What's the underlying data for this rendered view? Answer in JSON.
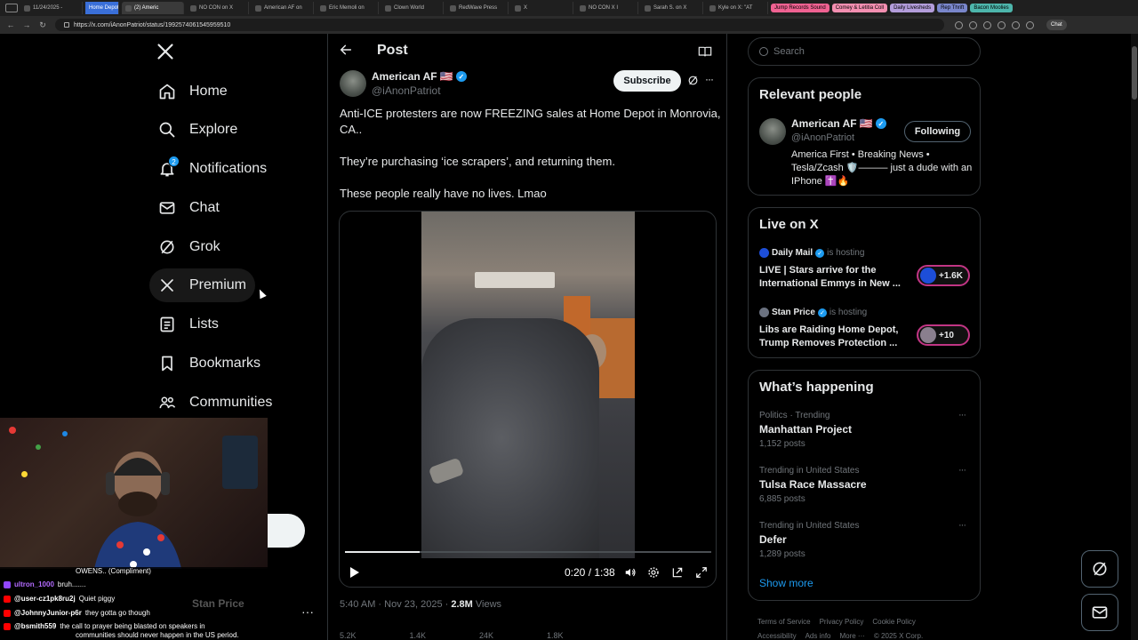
{
  "browser": {
    "tabs": [
      "11/24/2025 -",
      "Home Depot",
      "(2) Americ",
      "NO CON on X",
      "American AF on",
      "Eric Memoli on",
      "Clown World",
      "RedWave Press",
      "X",
      "NO CON X I",
      "Sarah S. on X",
      "Kyle on X: \"AT"
    ],
    "active_tab": "(2) Americ",
    "tab_groups": [
      {
        "label": "Jump Records Sound",
        "color": "#f06292"
      },
      {
        "label": "Comey & Letitia Coll",
        "color": "#f48fb1"
      },
      {
        "label": "Daily Livesheds",
        "color": "#b39ddb"
      },
      {
        "label": "Rep Thrift",
        "color": "#7986cb"
      },
      {
        "label": "Bacon Moolies",
        "color": "#4db6ac"
      }
    ],
    "url": "https://x.com/iAnonPatriot/status/1992574061545959510",
    "chat_label": "Chat"
  },
  "nav": {
    "logo": "X",
    "items": [
      {
        "label": "Home",
        "icon": "home-icon"
      },
      {
        "label": "Explore",
        "icon": "search-icon"
      },
      {
        "label": "Notifications",
        "icon": "bell-icon",
        "badge": "2"
      },
      {
        "label": "Chat",
        "icon": "mail-icon"
      },
      {
        "label": "Grok",
        "icon": "grok-icon"
      },
      {
        "label": "Premium",
        "icon": "x-logo-icon"
      },
      {
        "label": "Lists",
        "icon": "list-icon"
      },
      {
        "label": "Bookmarks",
        "icon": "bookmark-icon"
      },
      {
        "label": "Communities",
        "icon": "people-icon"
      }
    ]
  },
  "stream_chat": {
    "lines": [
      {
        "user": "",
        "text": "OWENS.. (Compliment)",
        "color": "#ffffff"
      },
      {
        "user": "ultron_1000",
        "text": "bruh.......",
        "color": "#b36bff"
      },
      {
        "user": "@user-cz1pk8ru2j",
        "text": "Quiet piggy",
        "color": "#ff3b30"
      },
      {
        "user": "@JohnnyJunior-p6r",
        "text": "they gotta go though",
        "color": "#ff3b30"
      },
      {
        "user": "@bsmith559",
        "text": "the call to prayer being blasted on speakers in",
        "color": "#ff3b30"
      },
      {
        "user": "",
        "text": "communities should never happen in the US period.",
        "color": "#ffffff"
      }
    ],
    "ghost_account": "Stan Price"
  },
  "post": {
    "header_title": "Post",
    "author_name": "American AF 🇺🇸",
    "author_handle": "@iAnonPatriot",
    "subscribe_label": "Subscribe",
    "text_lines": [
      "Anti-ICE protesters are now FREEZING sales at Home Depot in Monrovia, CA..",
      "They’re purchasing ‘ice scrapers’, and returning them.",
      "These people really have no lives. Lmao"
    ],
    "video": {
      "time": "0:20 / 1:38",
      "progress": 0.204
    },
    "timestamp": "5:40 AM · Nov 23, 2025 · ",
    "views_count": "2.8M",
    "views_label": " Views",
    "actions": [
      "5.2K",
      "1.4K",
      "24K",
      "1.8K"
    ]
  },
  "right": {
    "search_placeholder": "Search",
    "relevant_people": {
      "title": "Relevant people",
      "name": "American AF 🇺🇸",
      "handle": "@iAnonPatriot",
      "follow_label": "Following",
      "bio": "America First • Breaking News • Tesla/Zcash 🛡️——— just a dude with an IPhone ✝️🔥"
    },
    "live": {
      "title": "Live on X",
      "items": [
        {
          "host": "Daily Mail",
          "hosting": "is hosting",
          "title": "LIVE | Stars arrive for the International Emmys in New ...",
          "count": "+1.6K",
          "host_color": "#1d4ed8"
        },
        {
          "host": "Stan Price",
          "hosting": "is hosting",
          "title": "Libs are Raiding Home Depot, Trump Removes Protection ...",
          "count": "+10",
          "host_color": "#6b7280"
        }
      ]
    },
    "happening": {
      "title": "What’s happening",
      "trends": [
        {
          "category": "Politics · Trending",
          "name": "Manhattan Project",
          "count": "1,152 posts"
        },
        {
          "category": "Trending in United States",
          "name": "Tulsa Race Massacre",
          "count": "6,885 posts"
        },
        {
          "category": "Trending in United States",
          "name": "Defer",
          "count": "1,289 posts"
        }
      ],
      "show_more": "Show more"
    },
    "footer": [
      "Terms of Service",
      "Privacy Policy",
      "Cookie Policy",
      "Accessibility",
      "Ads info",
      "More ···",
      "© 2025 X Corp."
    ]
  }
}
